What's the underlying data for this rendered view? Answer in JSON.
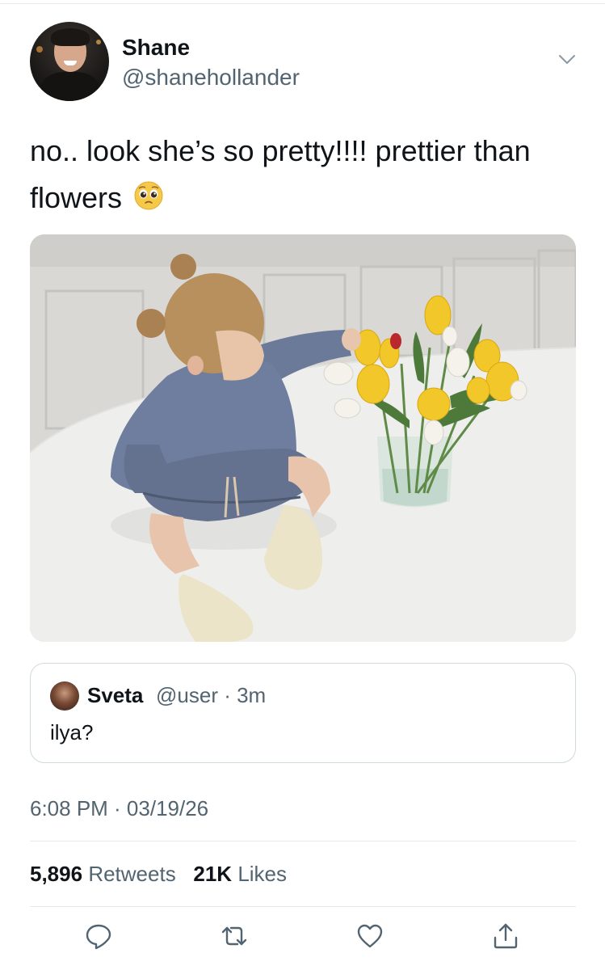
{
  "author": {
    "name": "Shane",
    "handle": "@shanehollander"
  },
  "tweet": {
    "text": "no.. look she’s so pretty!!!! prettier than flowers",
    "emoji": "pleading-face-emoji"
  },
  "quoted": {
    "name": "Sveta",
    "handle": "@user",
    "time": "· 3m",
    "text": "ilya?"
  },
  "meta": {
    "timestamp": "6:08 PM · 03/19/26"
  },
  "stats": {
    "retweets_count": "5,896",
    "retweets_label": "Retweets",
    "likes_count": "21K",
    "likes_label": "Likes"
  },
  "colors": {
    "text": "#0f1419",
    "secondary": "#536471",
    "border": "#cfd9de"
  },
  "icons": [
    "chevron-down-icon",
    "reply-icon",
    "retweet-icon",
    "like-icon",
    "share-icon"
  ]
}
